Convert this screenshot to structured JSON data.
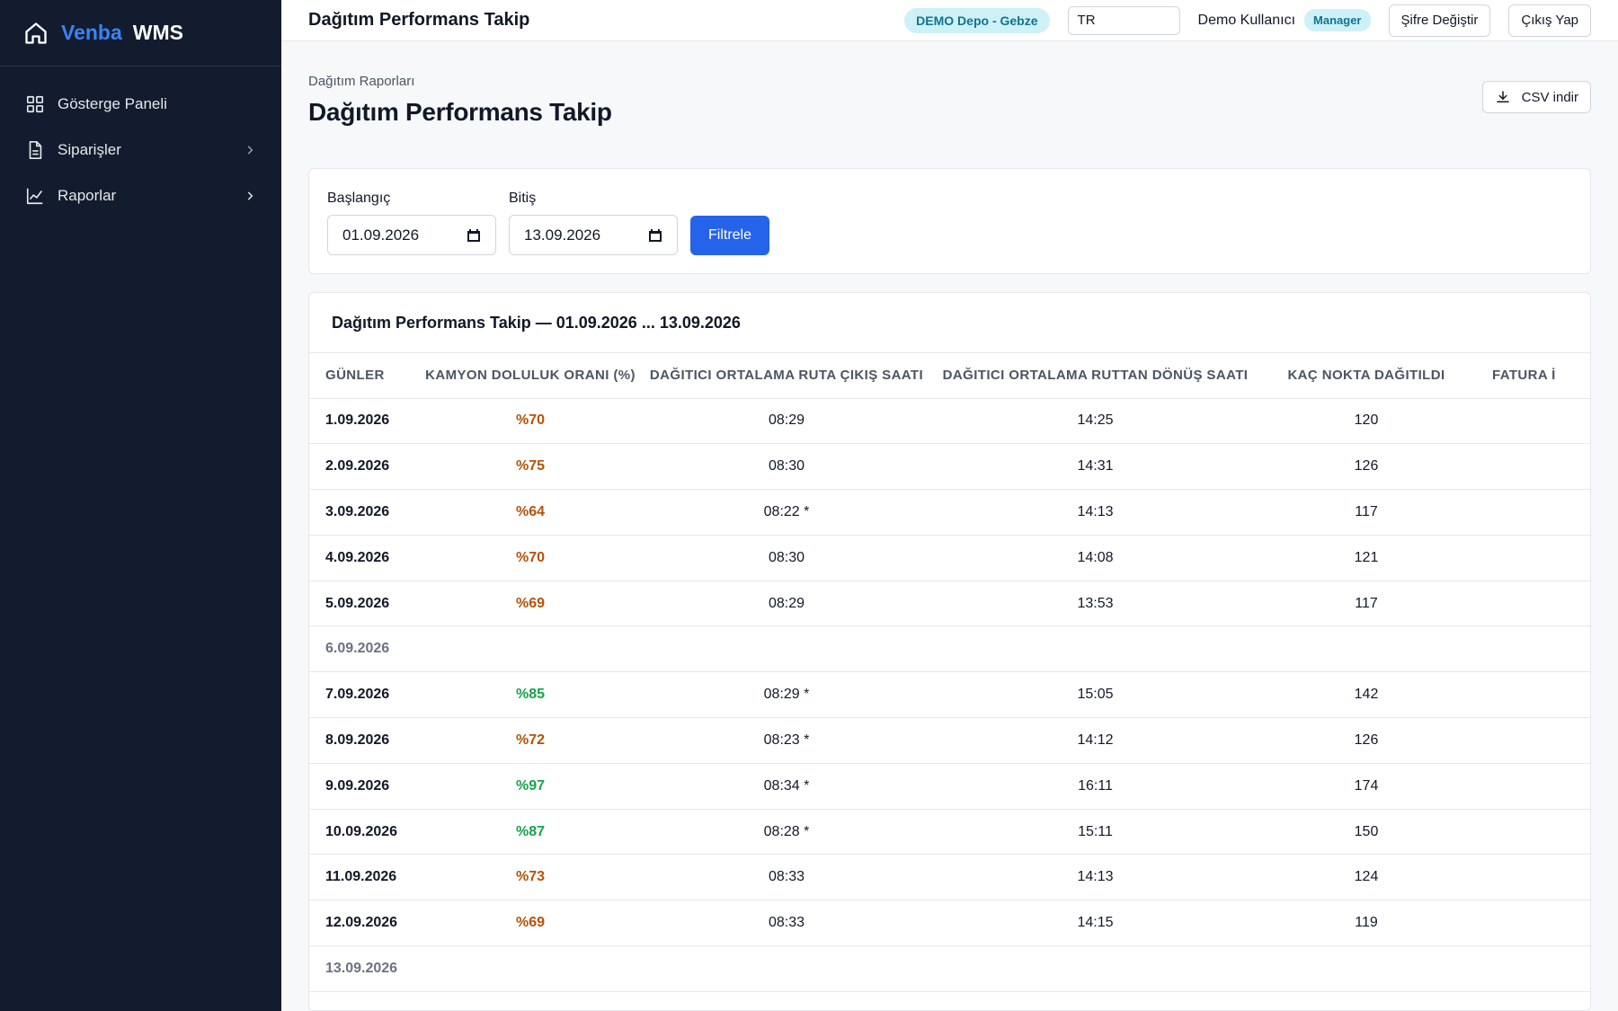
{
  "brand": {
    "name_part1": "Venba",
    "name_part2": "WMS"
  },
  "sidebar": {
    "items": [
      {
        "label": "Gösterge Paneli"
      },
      {
        "label": "Siparişler"
      },
      {
        "label": "Raporlar"
      }
    ]
  },
  "topbar": {
    "title": "Dağıtım Performans Takip",
    "depot_badge": "DEMO Depo - Gebze",
    "language": "TR",
    "user_name": "Demo Kullanıcı",
    "role_badge": "Manager",
    "change_password": "Şifre Değiştir",
    "logout": "Çıkış Yap"
  },
  "page": {
    "breadcrumb": "Dağıtım Raporları",
    "title": "Dağıtım Performans Takip",
    "csv_button": "CSV indir"
  },
  "filter": {
    "start_label": "Başlangıç",
    "start_value": "01.09.2026",
    "end_label": "Bitiş",
    "end_value": "13.09.2026",
    "button": "Filtrele"
  },
  "table": {
    "title": "Dağıtım Performans Takip — 01.09.2026 ... 13.09.2026",
    "columns": [
      "Günler",
      "Kamyon Doluluk Oranı (%)",
      "Dağıtıcı Ortalama Ruta Çıkış Saati",
      "Dağıtıcı Ortalama Ruttan Dönüş Saati",
      "Kaç Nokta Dağıtıldı",
      "Fatura İ"
    ],
    "rows": [
      {
        "day": "1.09.2026",
        "fill": "%70",
        "fill_status": "orange",
        "out": "08:29",
        "back": "14:25",
        "points": "120"
      },
      {
        "day": "2.09.2026",
        "fill": "%75",
        "fill_status": "orange",
        "out": "08:30",
        "back": "14:31",
        "points": "126"
      },
      {
        "day": "3.09.2026",
        "fill": "%64",
        "fill_status": "orange",
        "out": "08:22 *",
        "back": "14:13",
        "points": "117"
      },
      {
        "day": "4.09.2026",
        "fill": "%70",
        "fill_status": "orange",
        "out": "08:30",
        "back": "14:08",
        "points": "121"
      },
      {
        "day": "5.09.2026",
        "fill": "%69",
        "fill_status": "orange",
        "out": "08:29",
        "back": "13:53",
        "points": "117"
      },
      {
        "day": "6.09.2026",
        "fill": "",
        "fill_status": "none",
        "out": "",
        "back": "",
        "points": ""
      },
      {
        "day": "7.09.2026",
        "fill": "%85",
        "fill_status": "green",
        "out": "08:29 *",
        "back": "15:05",
        "points": "142"
      },
      {
        "day": "8.09.2026",
        "fill": "%72",
        "fill_status": "orange",
        "out": "08:23 *",
        "back": "14:12",
        "points": "126"
      },
      {
        "day": "9.09.2026",
        "fill": "%97",
        "fill_status": "green",
        "out": "08:34 *",
        "back": "16:11",
        "points": "174"
      },
      {
        "day": "10.09.2026",
        "fill": "%87",
        "fill_status": "green",
        "out": "08:28 *",
        "back": "15:11",
        "points": "150"
      },
      {
        "day": "11.09.2026",
        "fill": "%73",
        "fill_status": "orange",
        "out": "08:33",
        "back": "14:13",
        "points": "124"
      },
      {
        "day": "12.09.2026",
        "fill": "%69",
        "fill_status": "orange",
        "out": "08:33",
        "back": "14:15",
        "points": "119"
      },
      {
        "day": "13.09.2026",
        "fill": "",
        "fill_status": "none",
        "out": "",
        "back": "",
        "points": ""
      }
    ]
  },
  "colors": {
    "accent": "#2563eb",
    "sidebar_bg": "#121c2e",
    "status_orange": "#b45309",
    "status_green": "#16a34a",
    "badge_bg": "#cdf1f6"
  },
  "icons": {
    "brand": "home-icon",
    "dashboard": "grid-icon",
    "orders": "document-icon",
    "reports": "chart-line-icon",
    "download": "download-icon",
    "calendar": "calendar-icon"
  }
}
